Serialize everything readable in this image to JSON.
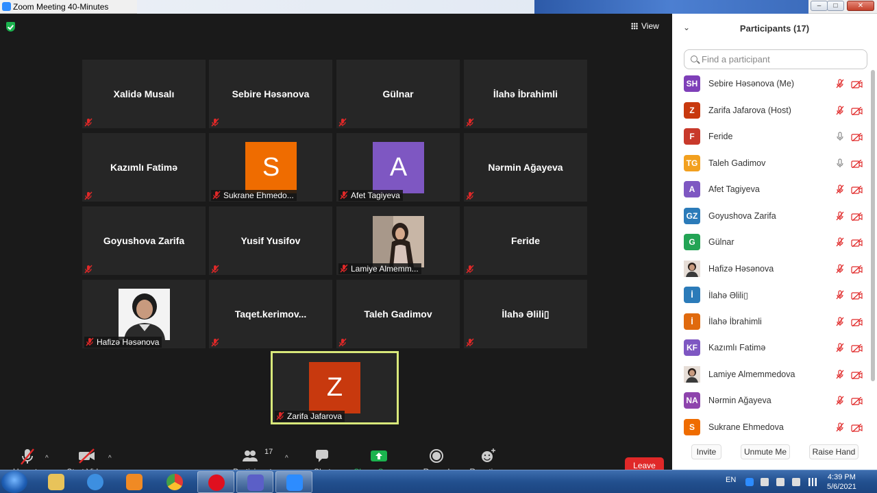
{
  "window": {
    "title": "Zoom Meeting 40-Minutes",
    "min": "–",
    "max": "□",
    "close": "✕"
  },
  "view_label": "View",
  "tiles": [
    {
      "name": "Xalidə Musalı"
    },
    {
      "name": "Sebire Həsənova"
    },
    {
      "name": "Gülnar"
    },
    {
      "name": "İlahə İbrahimli"
    },
    {
      "name": "Kazımlı Fatimə"
    },
    {
      "label": "Sukrane Ehmedo...",
      "initial": "S",
      "color": "#ef6c00"
    },
    {
      "label": "Afet Tagiyeva",
      "initial": "A",
      "color": "#7e57c2"
    },
    {
      "name": "Nərmin Ağayeva"
    },
    {
      "name": "Goyushova Zarifa"
    },
    {
      "name": "Yusif Yusifov"
    },
    {
      "label": "Lamiye Almemm..."
    },
    {
      "name": "Feride"
    },
    {
      "label": "Hafizə Həsənova"
    },
    {
      "name": "Taqet.kerimov..."
    },
    {
      "name": "Taleh Gadimov"
    },
    {
      "name": "İlahə  Əlili▯"
    },
    {
      "label": "Zarifa Jafarova",
      "initial": "Z",
      "color": "#c8390e"
    }
  ],
  "toolbar": {
    "unmute": "Unmute",
    "start_video": "Start Video",
    "participants": "Participants",
    "participants_count": "17",
    "chat": "Chat",
    "share_screen": "Share Screen",
    "record": "Record",
    "reactions": "Reactions",
    "leave": "Leave",
    "colors": {
      "share": "#1bb34e",
      "leave": "#e02828",
      "muted": "#e02828"
    }
  },
  "panel": {
    "title": "Participants (17)",
    "search_placeholder": "Find a participant",
    "participants": [
      {
        "initials": "SH",
        "name": "Sebire Həsənova (Me)",
        "color": "#7e3fb8",
        "mic": "muted"
      },
      {
        "initials": "Z",
        "name": "Zarifa Jafarova (Host)",
        "color": "#c8390e",
        "mic": "muted"
      },
      {
        "initials": "F",
        "name": "Feride",
        "color": "#c8392b",
        "mic": "on"
      },
      {
        "initials": "TG",
        "name": "Taleh Gadimov",
        "color": "#f2a01f",
        "mic": "on"
      },
      {
        "initials": "A",
        "name": "Afet Tagiyeva",
        "color": "#7e57c2",
        "mic": "muted"
      },
      {
        "initials": "GZ",
        "name": "Goyushova Zarifa",
        "color": "#2b7bb9",
        "mic": "muted"
      },
      {
        "initials": "G",
        "name": "Gülnar",
        "color": "#23a455",
        "mic": "muted"
      },
      {
        "initials": "",
        "name": "Hafizə Həsənova",
        "color": "#555",
        "mic": "muted",
        "photo": true
      },
      {
        "initials": "İ",
        "name": "İlahə Əlili▯",
        "color": "#2b7bb9",
        "mic": "muted"
      },
      {
        "initials": "İ",
        "name": "İlahə İbrahimli",
        "color": "#e06a0e",
        "mic": "muted"
      },
      {
        "initials": "KF",
        "name": "Kazımlı Fatimə",
        "color": "#7e57c2",
        "mic": "muted"
      },
      {
        "initials": "",
        "name": "Lamiye Almemmedova",
        "color": "#8a7a70",
        "mic": "muted",
        "photo": true
      },
      {
        "initials": "NA",
        "name": "Nərmin Ağayeva",
        "color": "#8e44ad",
        "mic": "muted"
      },
      {
        "initials": "S",
        "name": "Sukrane Ehmedova",
        "color": "#ef6c00",
        "mic": "muted"
      }
    ],
    "invite": "Invite",
    "unmute_me": "Unmute Me",
    "raise_hand": "Raise Hand"
  },
  "taskbar": {
    "lang": "EN",
    "time": "4:39 PM",
    "date": "5/6/2021"
  }
}
